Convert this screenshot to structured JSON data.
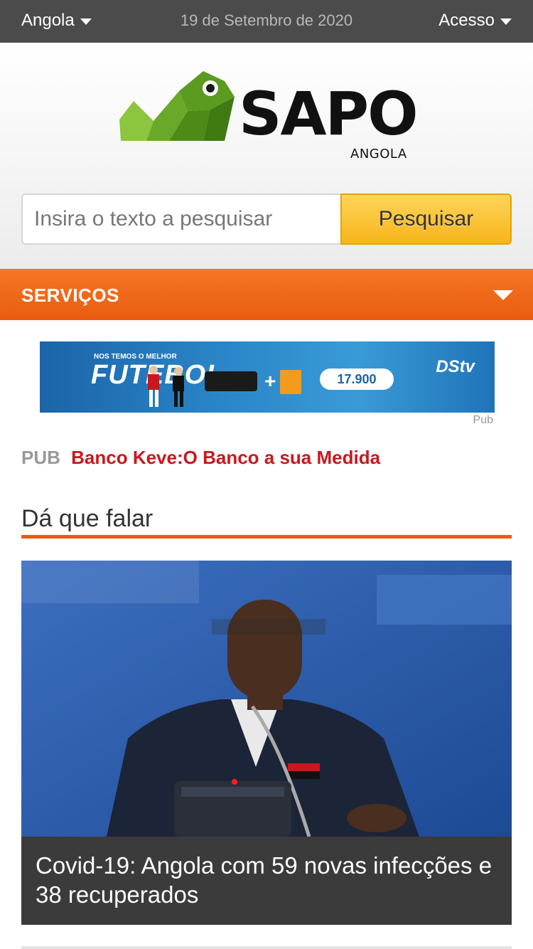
{
  "topbar": {
    "region_label": "Angola",
    "date": "19 de Setembro de 2020",
    "access_label": "Acesso"
  },
  "logo": {
    "word": "SAPO",
    "sub": "ANGOLA"
  },
  "search": {
    "placeholder": "Insira o texto a pesquisar",
    "button_label": "Pesquisar"
  },
  "services": {
    "label": "SERVIÇOS"
  },
  "banner": {
    "headline": "FUTEBOL",
    "tag": "NOS TEMOS O MELHOR",
    "price": "17.900",
    "brand": "DStv",
    "pub_label": "Pub"
  },
  "sponsored": {
    "tag": "PUB",
    "link_text": "Banco Keve:O Banco a sua Medida"
  },
  "section": {
    "title": "Dá que falar"
  },
  "featured": {
    "caption": "Covid-19: Angola com 59 novas infecções e 38 recuperados"
  },
  "colors": {
    "topbar_bg": "#4b4b4b",
    "accent_orange": "#ea5c10",
    "search_button": "#f6b51a",
    "link_red": "#c8181e",
    "caption_bg": "#3b3b3b"
  }
}
